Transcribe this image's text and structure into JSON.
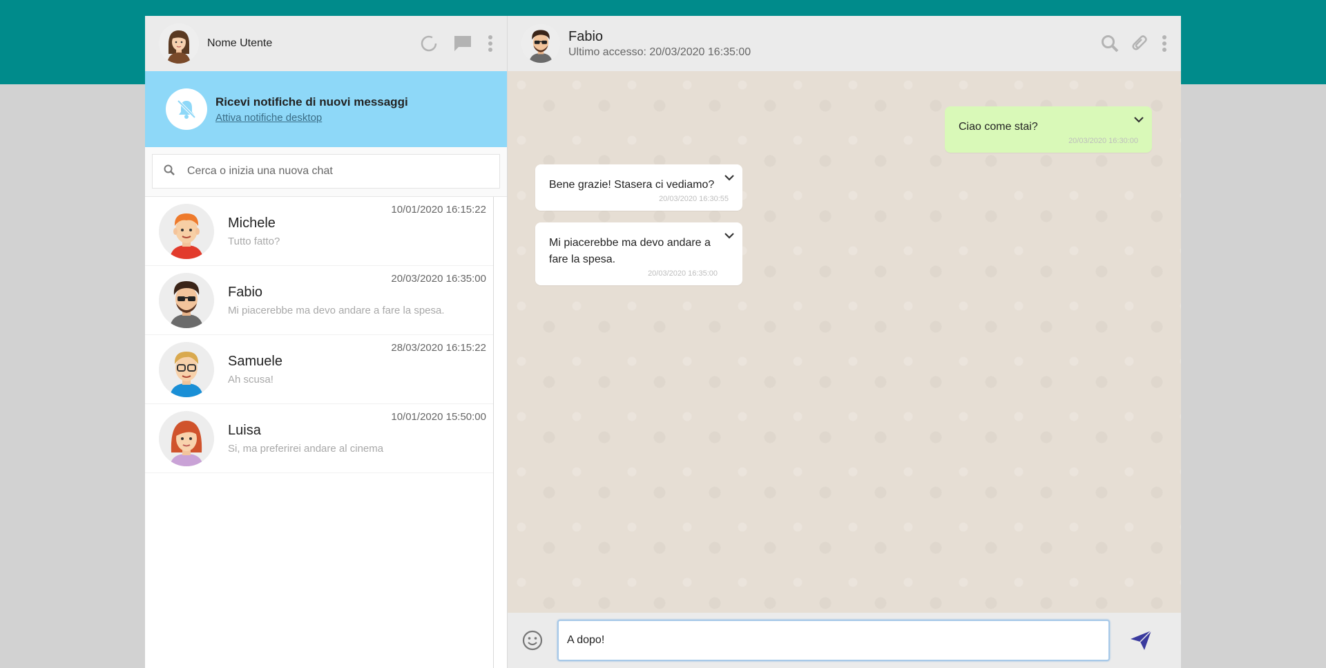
{
  "user": {
    "name": "Nome Utente",
    "avatar_icon": "female-user-avatar"
  },
  "left_header_icons": [
    "status-ring-icon",
    "chat-icon",
    "kebab-menu-icon"
  ],
  "notification": {
    "title": "Ricevi notifiche di nuovi messaggi",
    "link": "Attiva notifiche desktop",
    "icon": "bell-off-icon"
  },
  "search": {
    "placeholder": "Cerca o inizia una nuova chat"
  },
  "contacts": [
    {
      "name": "Michele",
      "last_message": "Tutto fatto?",
      "time": "10/01/2020 16:15:22",
      "avatar": "red-hair-boy"
    },
    {
      "name": "Fabio",
      "last_message": "Mi piacerebbe ma devo andare a fare la spesa.",
      "time": "20/03/2020 16:35:00",
      "avatar": "sunglasses-man"
    },
    {
      "name": "Samuele",
      "last_message": "Ah scusa!",
      "time": "28/03/2020 16:15:22",
      "avatar": "glasses-blond-man"
    },
    {
      "name": "Luisa",
      "last_message": "Si, ma preferirei andare al cinema",
      "time": "10/01/2020 15:50:00",
      "avatar": "red-hair-woman"
    }
  ],
  "chat": {
    "name": "Fabio",
    "last_seen": "Ultimo accesso: 20/03/2020 16:35:00",
    "header_icons": [
      "search-icon",
      "paperclip-icon",
      "kebab-menu-icon"
    ],
    "messages": [
      {
        "direction": "sent",
        "text": "Ciao come stai?",
        "time": "20/03/2020 16:30:00"
      },
      {
        "direction": "received",
        "text": "Bene grazie! Stasera ci vediamo?",
        "time": "20/03/2020 16:30:55"
      },
      {
        "direction": "received",
        "text": "Mi piacerebbe ma devo andare a fare la spesa.",
        "time": "20/03/2020 16:35:00"
      }
    ]
  },
  "composer": {
    "value": "A dopo!"
  },
  "colors": {
    "accent": "#008b8b",
    "notif_bg": "#8ed8f8",
    "sent_bubble": "#d9f9b8",
    "send_icon": "#3a3a9e"
  }
}
